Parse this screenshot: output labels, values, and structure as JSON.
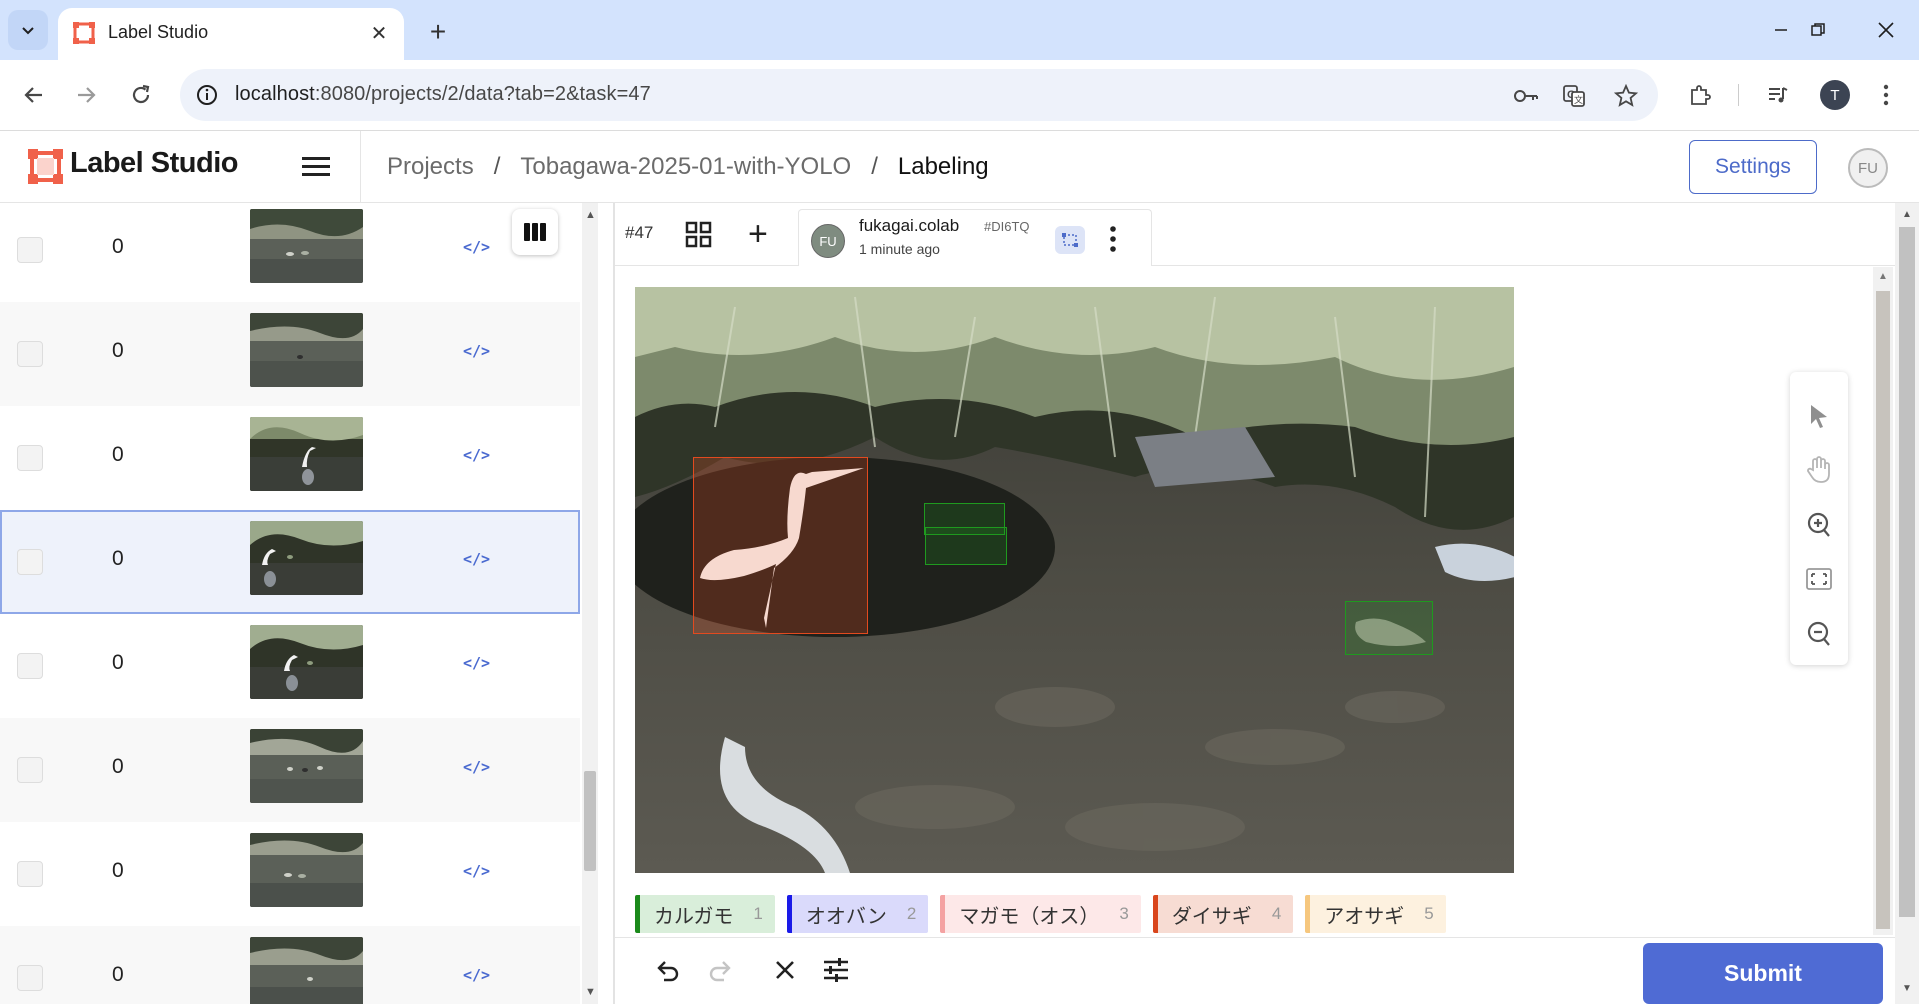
{
  "browser": {
    "tab_title": "Label Studio",
    "url_host": "localhost",
    "url_rest": ":8080/projects/2/data?tab=2&task=47",
    "profile_initial": "T"
  },
  "app": {
    "logo_text": "Label Studio",
    "breadcrumbs": [
      "Projects",
      "Tobagawa-2025-01-with-YOLO",
      "Labeling"
    ],
    "settings_label": "Settings",
    "user_initials": "FU"
  },
  "tasks": [
    {
      "count": "0",
      "thumb": "ducks-far"
    },
    {
      "count": "0",
      "thumb": "ducks-far"
    },
    {
      "count": "0",
      "thumb": "egret"
    },
    {
      "count": "0",
      "thumb": "egret",
      "selected": true
    },
    {
      "count": "0",
      "thumb": "egret"
    },
    {
      "count": "0",
      "thumb": "ducks-far"
    },
    {
      "count": "0",
      "thumb": "ducks-far"
    },
    {
      "count": "0",
      "thumb": "ducks-far"
    }
  ],
  "labeling": {
    "task_id": "#47",
    "annotation": {
      "avatar": "FU",
      "user": "fukagai.colab",
      "id": "#DI6TQ",
      "time": "1 minute ago"
    }
  },
  "labels": [
    {
      "name": "カルガモ",
      "hotkey": "1",
      "color": "#1b8a1b",
      "bg": "#d9eeda"
    },
    {
      "name": "オオバン",
      "hotkey": "2",
      "color": "#1a1ae8",
      "bg": "#dadafb"
    },
    {
      "name": "マガモ（オス）",
      "hotkey": "3",
      "color": "#f4a2a2",
      "bg": "#fde8e8"
    },
    {
      "name": "ダイサギ",
      "hotkey": "4",
      "color": "#d9461c",
      "bg": "#f7dcd3"
    },
    {
      "name": "アオサギ",
      "hotkey": "5",
      "color": "#f6c77e",
      "bg": "#fdf1df"
    }
  ],
  "regions": [
    {
      "label": "ダイサギ",
      "color": "#e24a1f"
    },
    {
      "label": "カルガモ",
      "color": "#1f9a1f"
    },
    {
      "label": "カルガモ",
      "color": "#1f9a1f"
    },
    {
      "label": "カルガモ",
      "color": "#1f9a1f"
    }
  ],
  "submit_label": "Submit"
}
